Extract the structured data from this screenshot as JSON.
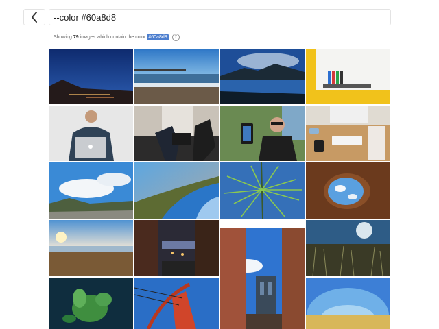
{
  "search": {
    "value": "--color #60a8d8"
  },
  "results": {
    "prefix": "Showing",
    "count": "79",
    "middle": "images which contain the color",
    "color_tag": "#60a8d8",
    "help": "?"
  },
  "back": {
    "icon": "chevron-left-icon"
  }
}
